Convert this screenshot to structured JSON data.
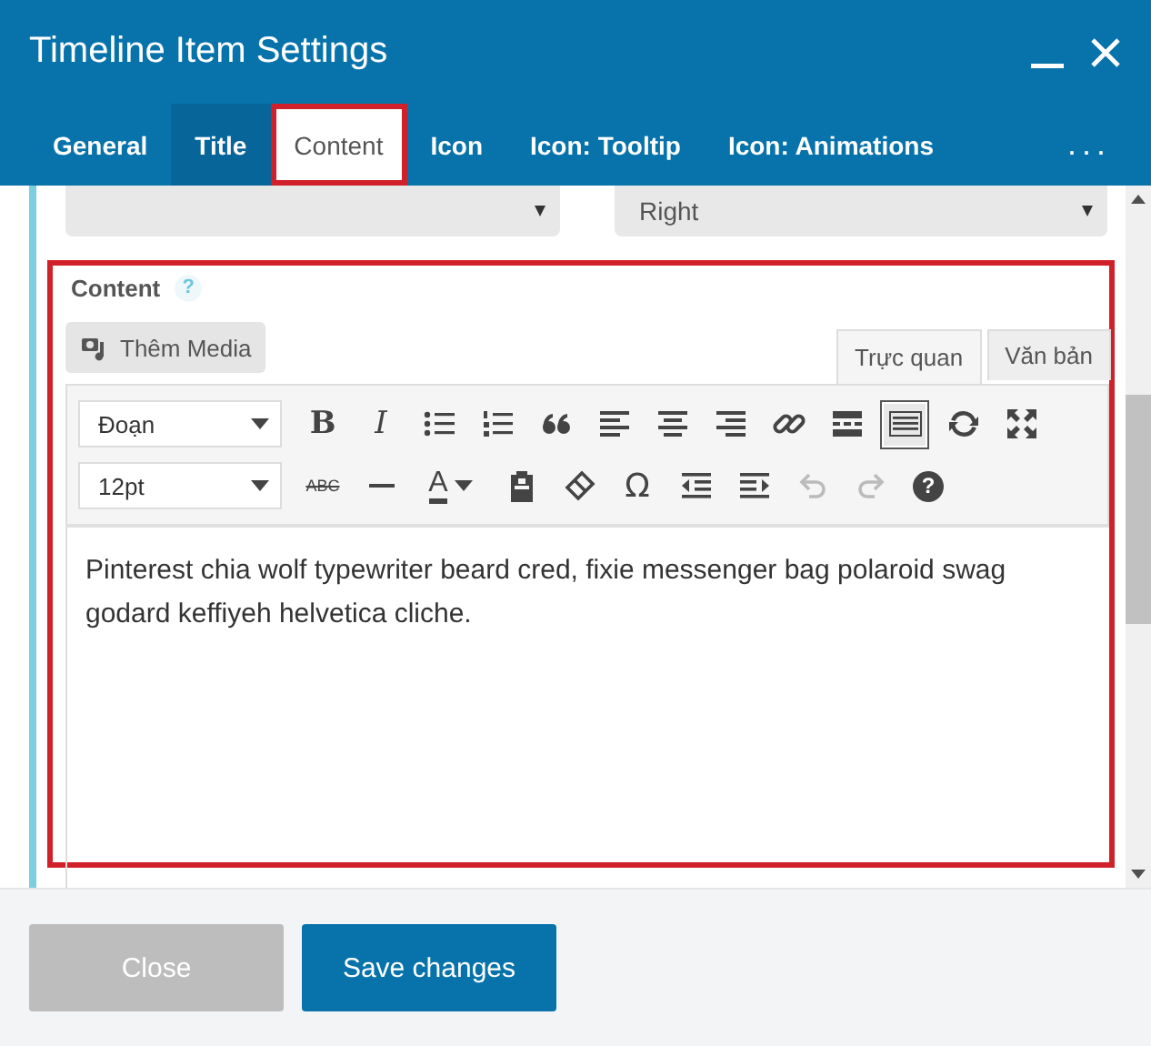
{
  "window": {
    "title": "Timeline Item Settings"
  },
  "tabs": [
    {
      "label": "General",
      "selected": false,
      "hovered": false,
      "outlined": false
    },
    {
      "label": "Title",
      "selected": false,
      "hovered": true,
      "outlined": false
    },
    {
      "label": "Content",
      "selected": true,
      "hovered": false,
      "outlined": true
    },
    {
      "label": "Icon",
      "selected": false,
      "hovered": false,
      "outlined": false
    },
    {
      "label": "Icon: Tooltip",
      "selected": false,
      "hovered": false,
      "outlined": false
    },
    {
      "label": "Icon: Animations",
      "selected": false,
      "hovered": false,
      "outlined": false
    }
  ],
  "tabs_more": "...",
  "alignment_select": {
    "value": "Right"
  },
  "content_field": {
    "label": "Content",
    "help": "?",
    "outlined": true,
    "media_button": "Thêm Media",
    "editor_tabs": [
      {
        "label": "Trực quan",
        "selected": true
      },
      {
        "label": "Văn bản",
        "selected": false
      }
    ],
    "toolbar_rows": [
      [
        {
          "kind": "select",
          "value": "Đoạn"
        },
        {
          "kind": "bold",
          "glyph": "B",
          "pressed": false,
          "disabled": false
        },
        {
          "kind": "italic",
          "glyph": "I",
          "pressed": false,
          "disabled": false
        },
        {
          "kind": "icon",
          "pressed": false,
          "disabled": false
        },
        {
          "kind": "icon",
          "pressed": false,
          "disabled": false
        },
        {
          "kind": "icon",
          "pressed": false,
          "disabled": false
        },
        {
          "kind": "icon",
          "pressed": false,
          "disabled": false
        },
        {
          "kind": "icon",
          "pressed": false,
          "disabled": false
        },
        {
          "kind": "icon",
          "pressed": false,
          "disabled": false
        },
        {
          "kind": "icon",
          "pressed": false,
          "disabled": false
        },
        {
          "kind": "icon",
          "pressed": false,
          "disabled": false
        },
        {
          "kind": "icon",
          "pressed": true,
          "disabled": false
        },
        {
          "kind": "icon",
          "pressed": false,
          "disabled": false
        },
        {
          "kind": "icon",
          "pressed": false,
          "disabled": false
        }
      ],
      [
        {
          "kind": "select",
          "value": "12pt"
        },
        {
          "kind": "strike",
          "glyph": "ABC",
          "pressed": false,
          "disabled": false
        },
        {
          "kind": "icon",
          "pressed": false,
          "disabled": false
        },
        {
          "kind": "color",
          "glyph": "A",
          "pressed": false,
          "disabled": false
        },
        {
          "kind": "icon",
          "pressed": false,
          "disabled": false
        },
        {
          "kind": "icon",
          "pressed": false,
          "disabled": false
        },
        {
          "kind": "glyph",
          "glyph": "Ω",
          "pressed": false,
          "disabled": false
        },
        {
          "kind": "icon",
          "pressed": false,
          "disabled": false
        },
        {
          "kind": "icon",
          "pressed": false,
          "disabled": false
        },
        {
          "kind": "icon",
          "pressed": false,
          "disabled": true
        },
        {
          "kind": "icon",
          "pressed": false,
          "disabled": true
        },
        {
          "kind": "help",
          "glyph": "?",
          "pressed": false,
          "disabled": false
        }
      ]
    ],
    "text": "Pinterest chia wolf typewriter beard cred, fixie messenger bag polaroid swag godard keffiyeh helvetica cliche."
  },
  "buttons": [
    {
      "label": "Close",
      "kind": "secondary"
    },
    {
      "label": "Save changes",
      "kind": "primary"
    }
  ]
}
